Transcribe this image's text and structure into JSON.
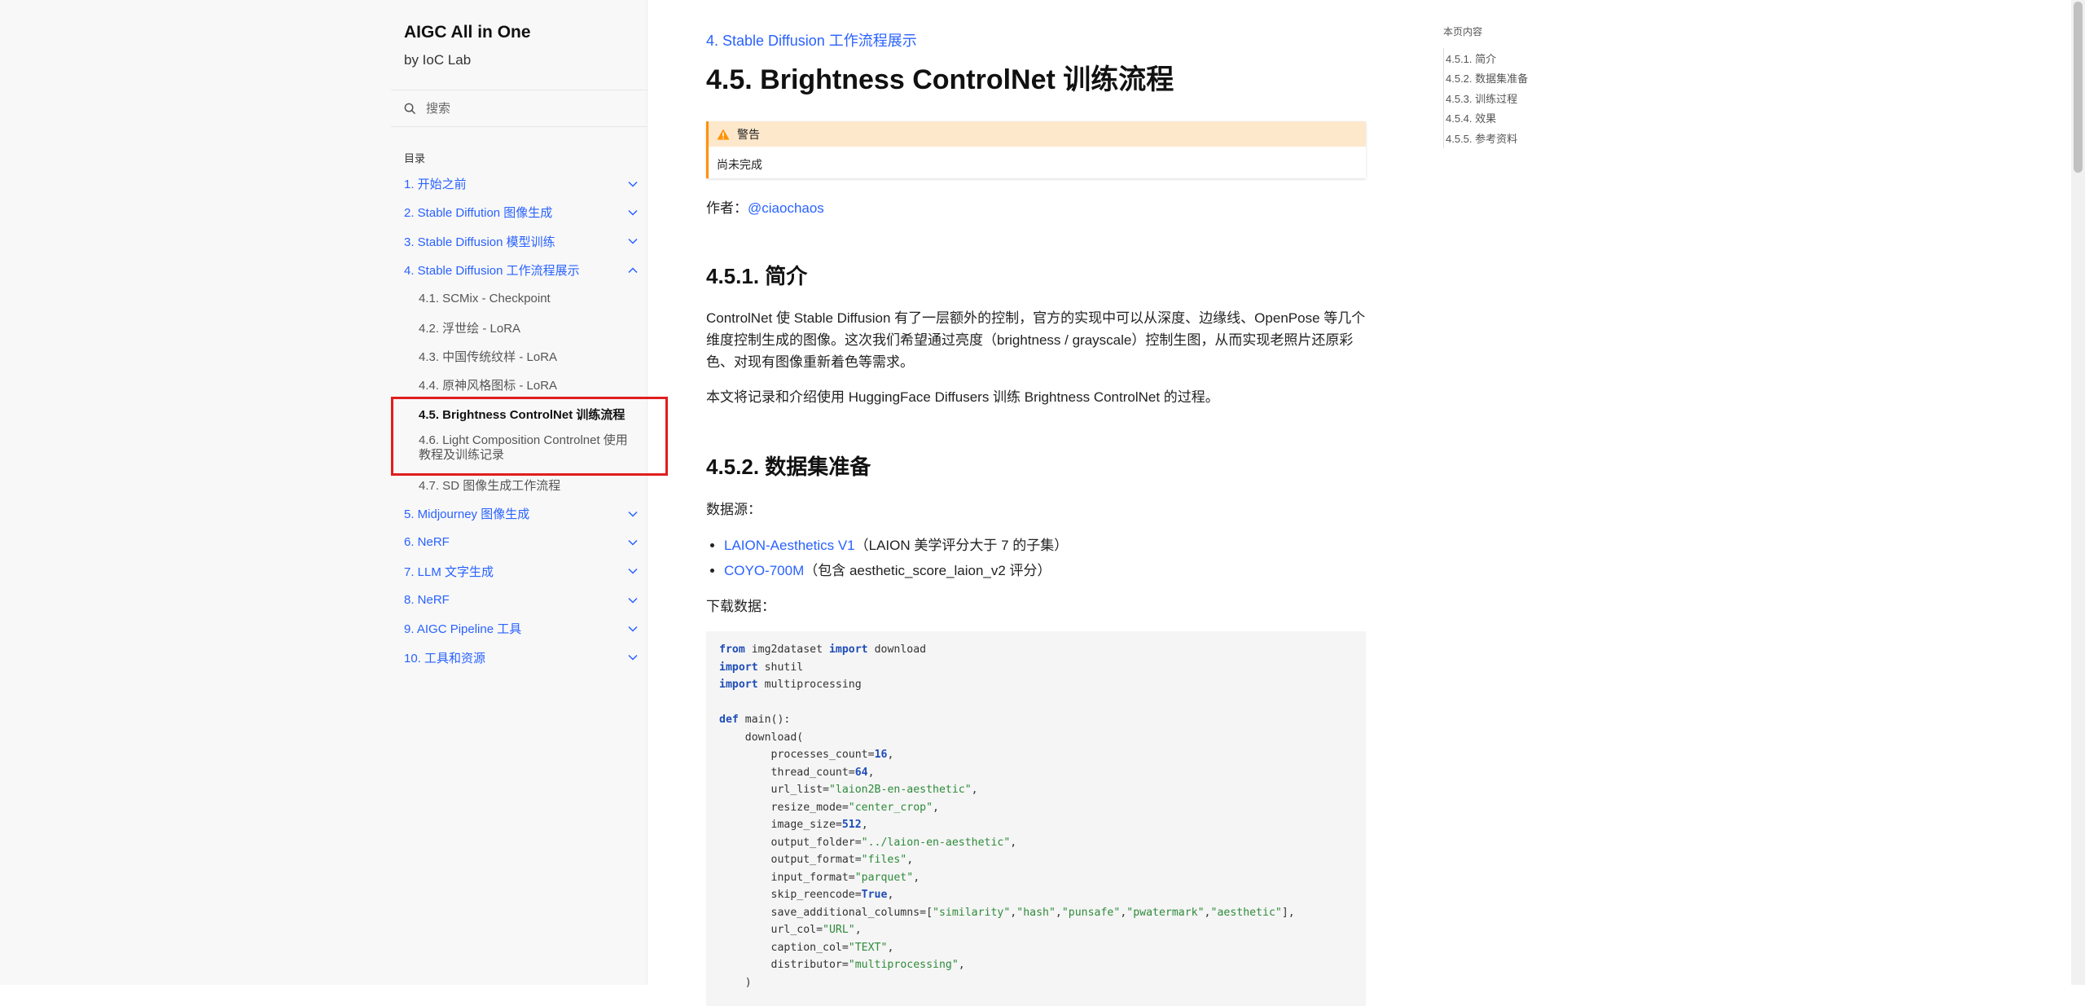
{
  "sidebar": {
    "title": "AIGC All in One",
    "subtitle": "by IoC Lab",
    "search_placeholder": "搜索",
    "toc_caption": "目录",
    "items": [
      {
        "label": "1. 开始之前"
      },
      {
        "label": "2. Stable Diffution 图像生成"
      },
      {
        "label": "3. Stable Diffusion 模型训练"
      },
      {
        "label": "4. Stable Diffusion 工作流程展示"
      },
      {
        "label": "5. Midjourney 图像生成"
      },
      {
        "label": "6. NeRF"
      },
      {
        "label": "7. LLM 文字生成"
      },
      {
        "label": "8. NeRF"
      },
      {
        "label": "9. AIGC Pipeline 工具"
      },
      {
        "label": "10. 工具和资源"
      }
    ],
    "subitems": [
      {
        "label": "4.1. SCMix - Checkpoint"
      },
      {
        "label": "4.2. 浮世绘 - LoRA"
      },
      {
        "label": "4.3. 中国传统纹样 - LoRA"
      },
      {
        "label": "4.4. 原神风格图标 - LoRA"
      },
      {
        "label": "4.5. Brightness ControlNet 训练流程"
      },
      {
        "label": "4.6. Light Composition Controlnet 使用教程及训练记录"
      },
      {
        "label": "4.7. SD 图像生成工作流程"
      }
    ]
  },
  "main": {
    "breadcrumb": "4. Stable Diffusion 工作流程展示",
    "title": "4.5. Brightness ControlNet 训练流程",
    "admonition": {
      "title": "警告",
      "body": "尚未完成"
    },
    "author_label": "作者：",
    "author_link": "@ciaochaos",
    "sections": {
      "intro_heading": "4.5.1. 简介",
      "intro_p1": "ControlNet 使 Stable Diffusion 有了一层额外的控制，官方的实现中可以从深度、边缘线、OpenPose 等几个维度控制生成的图像。这次我们希望通过亮度（brightness / grayscale）控制生图，从而实现老照片还原彩色、对现有图像重新着色等需求。",
      "intro_p2": "本文将记录和介绍使用 HuggingFace Diffusers 训练 Brightness ControlNet 的过程。",
      "data_heading": "4.5.2. 数据集准备",
      "data_source_label": "数据源：",
      "datasets": [
        {
          "link": "LAION-Aesthetics V1",
          "desc": "（LAION 美学评分大于 7 的子集）"
        },
        {
          "link": "COYO-700M",
          "desc": "（包含 aesthetic_score_laion_v2 评分）"
        }
      ],
      "download_label": "下载数据："
    },
    "code": {
      "lines": [
        [
          [
            "kw",
            "from"
          ],
          [
            "t",
            " img2dataset "
          ],
          [
            "kw",
            "import"
          ],
          [
            "t",
            " download"
          ]
        ],
        [
          [
            "kw",
            "import"
          ],
          [
            "t",
            " shutil"
          ]
        ],
        [
          [
            "kw",
            "import"
          ],
          [
            "t",
            " multiprocessing"
          ]
        ],
        [
          [
            "t",
            ""
          ]
        ],
        [
          [
            "kw",
            "def"
          ],
          [
            "t",
            " main():"
          ]
        ],
        [
          [
            "t",
            "    download("
          ]
        ],
        [
          [
            "t",
            "        processes_count="
          ],
          [
            "num",
            "16"
          ],
          [
            "t",
            ","
          ]
        ],
        [
          [
            "t",
            "        thread_count="
          ],
          [
            "num",
            "64"
          ],
          [
            "t",
            ","
          ]
        ],
        [
          [
            "t",
            "        url_list="
          ],
          [
            "str",
            "\"laion2B-en-aesthetic\""
          ],
          [
            "t",
            ","
          ]
        ],
        [
          [
            "t",
            "        resize_mode="
          ],
          [
            "str",
            "\"center_crop\""
          ],
          [
            "t",
            ","
          ]
        ],
        [
          [
            "t",
            "        image_size="
          ],
          [
            "num",
            "512"
          ],
          [
            "t",
            ","
          ]
        ],
        [
          [
            "t",
            "        output_folder="
          ],
          [
            "str",
            "\"../laion-en-aesthetic\""
          ],
          [
            "t",
            ","
          ]
        ],
        [
          [
            "t",
            "        output_format="
          ],
          [
            "str",
            "\"files\""
          ],
          [
            "t",
            ","
          ]
        ],
        [
          [
            "t",
            "        input_format="
          ],
          [
            "str",
            "\"parquet\""
          ],
          [
            "t",
            ","
          ]
        ],
        [
          [
            "t",
            "        skip_reencode="
          ],
          [
            "kw",
            "True"
          ],
          [
            "t",
            ","
          ]
        ],
        [
          [
            "t",
            "        save_additional_columns=["
          ],
          [
            "str",
            "\"similarity\""
          ],
          [
            "t",
            ","
          ],
          [
            "str",
            "\"hash\""
          ],
          [
            "t",
            ","
          ],
          [
            "str",
            "\"punsafe\""
          ],
          [
            "t",
            ","
          ],
          [
            "str",
            "\"pwatermark\""
          ],
          [
            "t",
            ","
          ],
          [
            "str",
            "\"aesthetic\""
          ],
          [
            "t",
            "],"
          ]
        ],
        [
          [
            "t",
            "        url_col="
          ],
          [
            "str",
            "\"URL\""
          ],
          [
            "t",
            ","
          ]
        ],
        [
          [
            "t",
            "        caption_col="
          ],
          [
            "str",
            "\"TEXT\""
          ],
          [
            "t",
            ","
          ]
        ],
        [
          [
            "t",
            "        distributor="
          ],
          [
            "str",
            "\"multiprocessing\""
          ],
          [
            "t",
            ","
          ]
        ],
        [
          [
            "t",
            "    )"
          ]
        ]
      ]
    }
  },
  "right_toc": {
    "title": "本页内容",
    "items": [
      {
        "label": "4.5.1. 简介"
      },
      {
        "label": "4.5.2. 数据集准备"
      },
      {
        "label": "4.5.3. 训练过程"
      },
      {
        "label": "4.5.4. 效果"
      },
      {
        "label": "4.5.5. 参考资料"
      }
    ]
  },
  "colors": {
    "link": "#2962ff",
    "warning": "#ff9100",
    "highlight_box": "#e01e1e"
  }
}
